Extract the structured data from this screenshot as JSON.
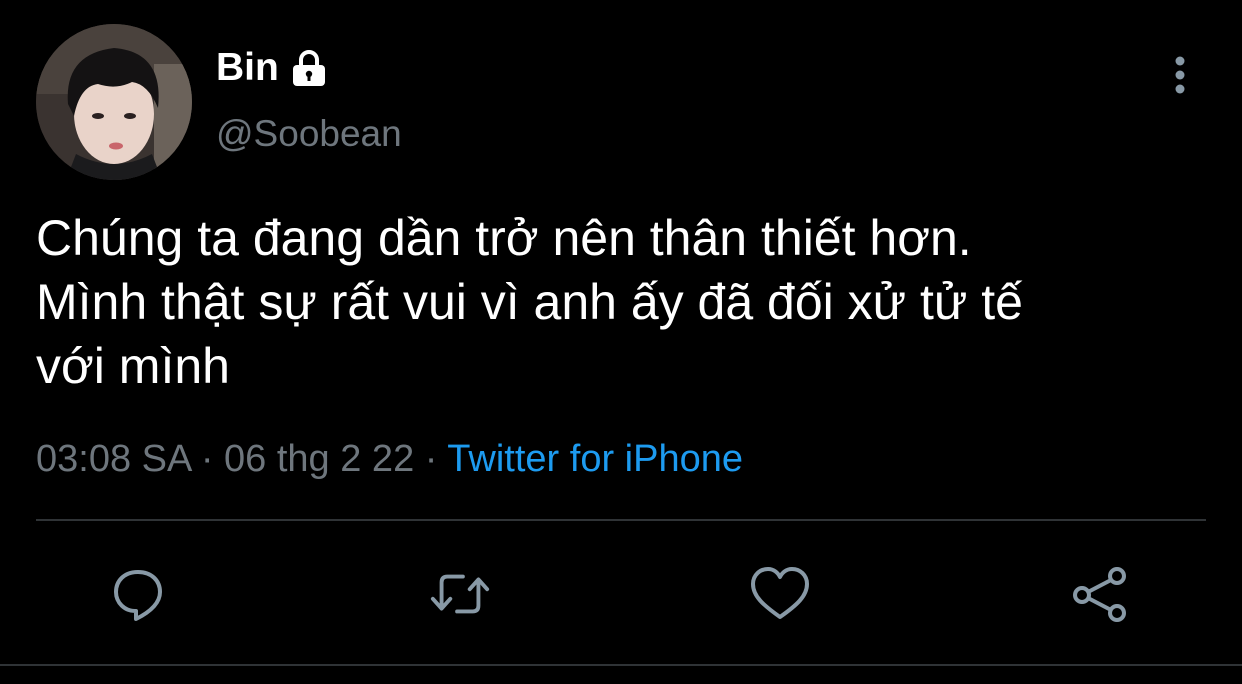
{
  "user": {
    "display_name": "Bin",
    "handle": "@Soobean",
    "locked": true
  },
  "tweet": {
    "lines": [
      "Chúng ta đang dần trở nên thân thiết hơn.",
      "Mình thật sự rất vui vì anh ấy đã đối xử tử tế",
      "với mình"
    ],
    "time": "03:08 SA",
    "separator": "·",
    "date": "06 thg 2 22",
    "source": "Twitter for iPhone"
  },
  "actions": [
    {
      "name": "reply",
      "icon": "reply-bubble-icon"
    },
    {
      "name": "retweet",
      "icon": "retweet-icon"
    },
    {
      "name": "like",
      "icon": "heart-icon"
    },
    {
      "name": "share",
      "icon": "share-icon"
    }
  ],
  "colors": {
    "background": "#000000",
    "text_primary": "#ffffff",
    "text_secondary": "#6e767d",
    "accent": "#1d9bf0",
    "divider": "#2f3336",
    "icon": "#8899a6"
  }
}
